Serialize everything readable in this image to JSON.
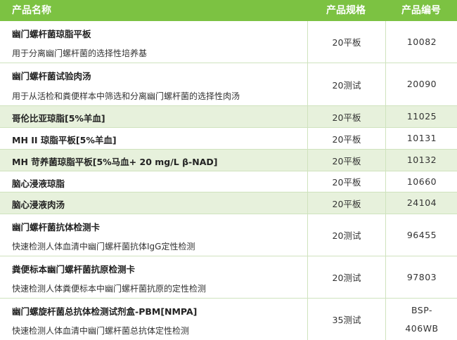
{
  "header": {
    "name": "产品名称",
    "spec": "产品规格",
    "code": "产品编号"
  },
  "rows": [
    {
      "name": "幽门螺杆菌琼脂平板",
      "desc": "用于分离幽门螺杆菌的选择性培养基",
      "spec": "20平板",
      "code": "10082"
    },
    {
      "name": "幽门螺杆菌试验肉汤",
      "desc": "用于从活检和粪便样本中筛选和分离幽门螺杆菌的选择性肉汤",
      "spec": "20测试",
      "code": "20090"
    },
    {
      "name": "哥伦比亚琼脂[5%羊血]",
      "desc": "",
      "spec": "20平板",
      "code": "11025"
    },
    {
      "name": "MH II 琼脂平板[5%羊血]",
      "desc": "",
      "spec": "20平板",
      "code": "10131"
    },
    {
      "name": "MH 苛养菌琼脂平板[5%马血+ 20 mg/L β-NAD]",
      "desc": "",
      "spec": "20平板",
      "code": "10132"
    },
    {
      "name": "脑心浸液琼脂",
      "desc": "",
      "spec": "20平板",
      "code": "10660"
    },
    {
      "name": "脑心浸液肉汤",
      "desc": "",
      "spec": "20平板",
      "code": "24104"
    },
    {
      "name": "幽门螺杆菌抗体检测卡",
      "desc": "快速检测人体血清中幽门螺杆菌抗体IgG定性检测",
      "spec": "20测试",
      "code": "96455"
    },
    {
      "name": "粪便标本幽门螺杆菌抗原检测卡",
      "desc": "快速检测人体粪便标本中幽门螺杆菌抗原的定性检测",
      "spec": "20测试",
      "code": "97803"
    },
    {
      "name": "幽门螺旋杆菌总抗体检测试剂盒-PBM[NMPA]",
      "desc": "快速检测人体血清中幽门螺杆菌总抗体定性检测",
      "spec": "35测试",
      "code": "BSP-\n406WB"
    }
  ]
}
